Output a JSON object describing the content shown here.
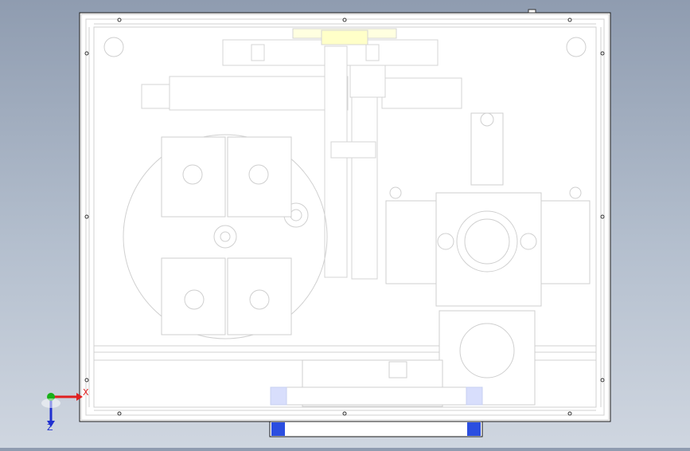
{
  "viewport": {
    "name": "cad-graphics-area",
    "background_top": "#8f9cb0",
    "background_bottom": "#cfd6e0"
  },
  "colors": {
    "frame_stroke": "#1a1a1a",
    "part_stroke": "#d4d4d4",
    "part_fill": "#ffffff",
    "highlight_yellow": "#ffffc8",
    "blue_block": "#2b4ee0",
    "blue_block_light": "#d8defc",
    "axis_x": "#e02020",
    "axis_y": "#18b018",
    "axis_z": "#2030d0"
  },
  "triad": {
    "x_label": "X",
    "z_label": "Z"
  }
}
